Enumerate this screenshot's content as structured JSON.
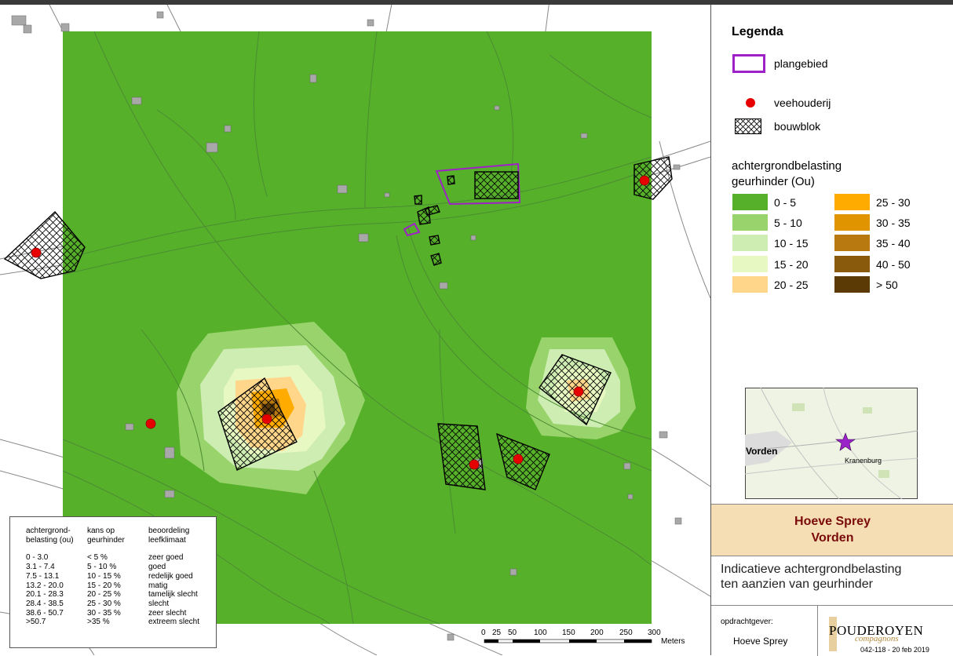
{
  "legend": {
    "title": "Legenda",
    "plan_area_label": "plangebied",
    "farm_label": "veehouderij",
    "building_block_label": "bouwblok",
    "odour_title_line1": "achtergrondbelasting",
    "odour_title_line2": "geurhinder (Ou)",
    "classes": [
      {
        "label": "0 - 5",
        "color": "#56b02a"
      },
      {
        "label": "5 - 10",
        "color": "#99d36b"
      },
      {
        "label": "10 - 15",
        "color": "#cdedb2"
      },
      {
        "label": "15 - 20",
        "color": "#e8f8c2"
      },
      {
        "label": "20 - 25",
        "color": "#ffd68a"
      },
      {
        "label": "25 - 30",
        "color": "#ffab00"
      },
      {
        "label": "30 - 35",
        "color": "#e09400"
      },
      {
        "label": "35 - 40",
        "color": "#b87a10"
      },
      {
        "label": "40 - 50",
        "color": "#8a5a0c"
      },
      {
        "label": "> 50",
        "color": "#5c3a06"
      }
    ],
    "plan_color": "#a020c8",
    "farm_color": "#e60000"
  },
  "inset_map": {
    "place_label": "Vorden",
    "star_label": "Kranenburg",
    "star_color": "#9b22c8"
  },
  "title": {
    "line1": "Hoeve Sprey",
    "line2": "Vorden"
  },
  "subtitle": {
    "line1": "Indicatieve achtergrondbelasting",
    "line2": "ten aanzien van geurhinder"
  },
  "footer": {
    "client_label": "opdrachtgever:",
    "client_name": "Hoeve Sprey",
    "company_name": "POUDEROYEN",
    "company_sub": "compagnons",
    "reference": "042-118 - 20 feb 2019"
  },
  "classification_table": {
    "headers": [
      [
        "achtergrond-",
        "belasting (ou)"
      ],
      [
        "kans op",
        "geurhinder"
      ],
      [
        "beoordeling",
        "leefklimaat"
      ]
    ],
    "rows": [
      [
        "0 - 3.0",
        "< 5 %",
        "zeer goed"
      ],
      [
        "3.1 - 7.4",
        "5 - 10 %",
        "goed"
      ],
      [
        "7.5 - 13.1",
        "10 - 15 %",
        "redelijk goed"
      ],
      [
        "13.2 - 20.0",
        "15 - 20 %",
        "matig"
      ],
      [
        "20.1 - 28.3",
        "20 - 25 %",
        "tamelijk slecht"
      ],
      [
        "28.4 - 38.5",
        "25 - 30 %",
        "slecht"
      ],
      [
        "38.6 - 50.7",
        "30 - 35 %",
        "zeer slecht"
      ],
      [
        ">50.7",
        ">35  %",
        "extreem slecht"
      ]
    ]
  },
  "scale_bar": {
    "labels": [
      "0",
      "25",
      "50",
      "100",
      "150",
      "200",
      "250",
      "300"
    ],
    "unit": "Meters"
  }
}
